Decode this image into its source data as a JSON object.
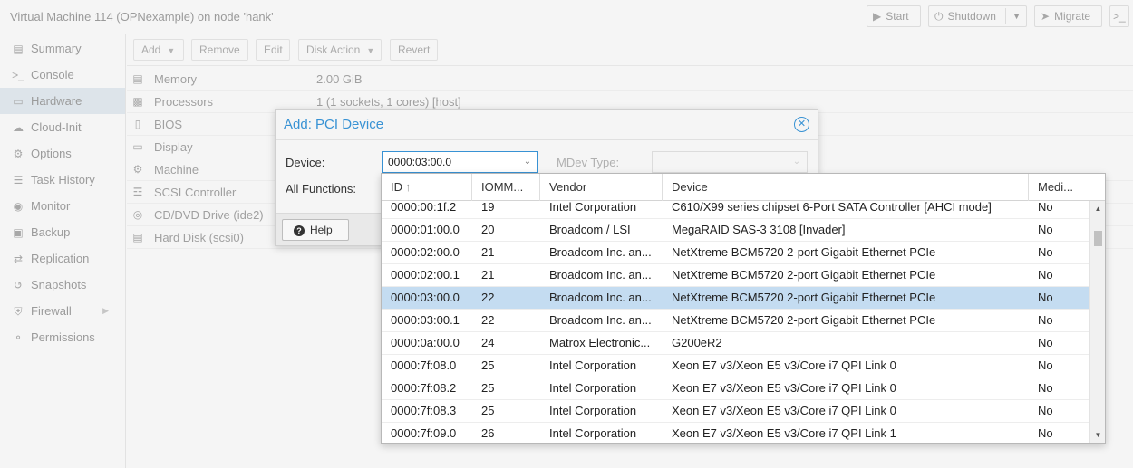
{
  "window": {
    "title": "Virtual Machine 114 (OPNexample) on node 'hank'",
    "buttons": {
      "start": "Start",
      "shutdown": "Shutdown",
      "migrate": "Migrate"
    }
  },
  "sidebar": {
    "items": [
      {
        "label": "Summary",
        "icon": "book-icon"
      },
      {
        "label": "Console",
        "icon": "terminal-icon"
      },
      {
        "label": "Hardware",
        "icon": "desktop-icon",
        "active": true
      },
      {
        "label": "Cloud-Init",
        "icon": "cloud-icon"
      },
      {
        "label": "Options",
        "icon": "gear-icon"
      },
      {
        "label": "Task History",
        "icon": "list-icon"
      },
      {
        "label": "Monitor",
        "icon": "eye-icon"
      },
      {
        "label": "Backup",
        "icon": "floppy-icon"
      },
      {
        "label": "Replication",
        "icon": "retweet-icon"
      },
      {
        "label": "Snapshots",
        "icon": "history-icon"
      },
      {
        "label": "Firewall",
        "icon": "shield-icon"
      },
      {
        "label": "Permissions",
        "icon": "unlock-icon"
      }
    ]
  },
  "hardware": {
    "toolbar": {
      "add": "Add",
      "remove": "Remove",
      "edit": "Edit",
      "disk_action": "Disk Action",
      "revert": "Revert"
    },
    "rows": [
      {
        "key": "Memory",
        "value": "2.00 GiB",
        "icon": "memory-icon"
      },
      {
        "key": "Processors",
        "value": "1 (1 sockets, 1 cores) [host]",
        "icon": "cpu-icon"
      },
      {
        "key": "BIOS",
        "value": "",
        "icon": "bios-icon"
      },
      {
        "key": "Display",
        "value": "",
        "icon": "display-icon"
      },
      {
        "key": "Machine",
        "value": "",
        "icon": "cogs-icon"
      },
      {
        "key": "SCSI Controller",
        "value": "",
        "icon": "database-icon"
      },
      {
        "key": "CD/DVD Drive (ide2)",
        "value": "",
        "icon": "cdrom-icon"
      },
      {
        "key": "Hard Disk (scsi0)",
        "value": "",
        "icon": "hdd-icon"
      }
    ]
  },
  "dialog": {
    "title": "Add: PCI Device",
    "device_label": "Device:",
    "device_value": "0000:03:00.0",
    "mdev_label": "MDev Type:",
    "all_functions_label": "All Functions:",
    "help": "Help"
  },
  "picker": {
    "columns": [
      "ID",
      "IOMM...",
      "Vendor",
      "Device",
      "Medi..."
    ],
    "selected_index": 4,
    "rows": [
      {
        "id": "0000:00:1f.2",
        "iommu": "19",
        "vendor": "Intel Corporation",
        "device": "C610/X99 series chipset 6-Port SATA Controller [AHCI mode]",
        "mdev": "No"
      },
      {
        "id": "0000:01:00.0",
        "iommu": "20",
        "vendor": "Broadcom / LSI",
        "device": "MegaRAID SAS-3 3108 [Invader]",
        "mdev": "No"
      },
      {
        "id": "0000:02:00.0",
        "iommu": "21",
        "vendor": "Broadcom Inc. an...",
        "device": "NetXtreme BCM5720 2-port Gigabit Ethernet PCIe",
        "mdev": "No"
      },
      {
        "id": "0000:02:00.1",
        "iommu": "21",
        "vendor": "Broadcom Inc. an...",
        "device": "NetXtreme BCM5720 2-port Gigabit Ethernet PCIe",
        "mdev": "No"
      },
      {
        "id": "0000:03:00.0",
        "iommu": "22",
        "vendor": "Broadcom Inc. an...",
        "device": "NetXtreme BCM5720 2-port Gigabit Ethernet PCIe",
        "mdev": "No"
      },
      {
        "id": "0000:03:00.1",
        "iommu": "22",
        "vendor": "Broadcom Inc. an...",
        "device": "NetXtreme BCM5720 2-port Gigabit Ethernet PCIe",
        "mdev": "No"
      },
      {
        "id": "0000:0a:00.0",
        "iommu": "24",
        "vendor": "Matrox Electronic...",
        "device": "G200eR2",
        "mdev": "No"
      },
      {
        "id": "0000:7f:08.0",
        "iommu": "25",
        "vendor": "Intel Corporation",
        "device": "Xeon E7 v3/Xeon E5 v3/Core i7 QPI Link 0",
        "mdev": "No"
      },
      {
        "id": "0000:7f:08.2",
        "iommu": "25",
        "vendor": "Intel Corporation",
        "device": "Xeon E7 v3/Xeon E5 v3/Core i7 QPI Link 0",
        "mdev": "No"
      },
      {
        "id": "0000:7f:08.3",
        "iommu": "25",
        "vendor": "Intel Corporation",
        "device": "Xeon E7 v3/Xeon E5 v3/Core i7 QPI Link 0",
        "mdev": "No"
      },
      {
        "id": "0000:7f:09.0",
        "iommu": "26",
        "vendor": "Intel Corporation",
        "device": "Xeon E7 v3/Xeon E5 v3/Core i7 QPI Link 1",
        "mdev": "No"
      }
    ]
  },
  "colors": {
    "accent": "#3892d4",
    "selected_row": "#c4dcf1",
    "active_nav": "#dde4ea"
  }
}
